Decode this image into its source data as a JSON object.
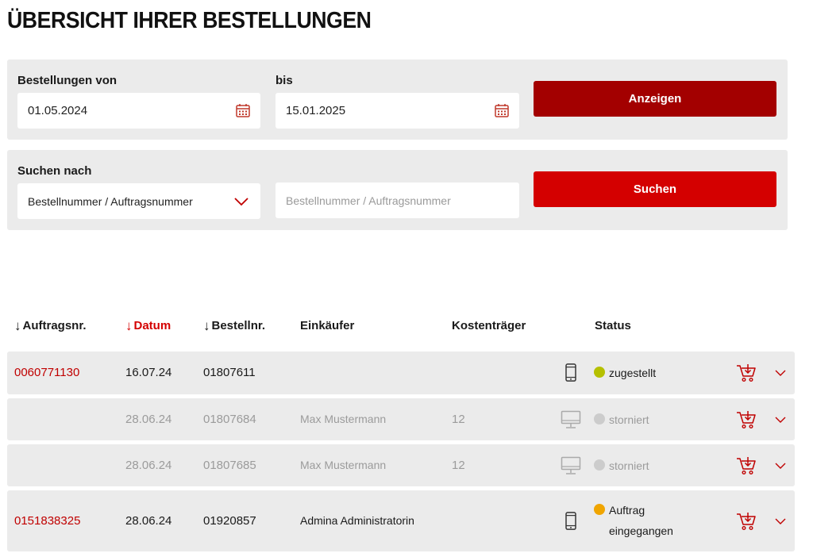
{
  "page": {
    "title": "ÜBERSICHT IHRER BESTELLUNGEN"
  },
  "date_filter": {
    "from_label": "Bestellungen von",
    "from_value": "01.05.2024",
    "to_label": "bis",
    "to_value": "15.01.2025",
    "button_label": "Anzeigen"
  },
  "search": {
    "label": "Suchen nach",
    "select_value": "Bestellnummer / Auftragsnummer",
    "input_placeholder": "Bestellnummer / Auftragsnummer",
    "button_label": "Suchen"
  },
  "table": {
    "headers": {
      "auftragsnr": "Auftragsnr.",
      "datum": "Datum",
      "bestellnr": "Bestellnr.",
      "einkaeufer": "Einkäufer",
      "kostentraeger": "Kostenträger",
      "status": "Status"
    },
    "rows": [
      {
        "auftragsnr": "0060771130",
        "datum": "16.07.24",
        "bestellnr": "01807611",
        "einkaeufer": "",
        "kostentraeger": "",
        "device": "mobile-icon",
        "status_line1": "zugestellt",
        "status_line2": "",
        "status_color": "#b5c000",
        "muted": false
      },
      {
        "auftragsnr": "",
        "datum": "28.06.24",
        "bestellnr": "01807684",
        "einkaeufer": "Max Mustermann",
        "kostentraeger": "12",
        "device": "desktop-icon",
        "status_line1": "storniert",
        "status_line2": "",
        "status_color": "#cccccc",
        "muted": true
      },
      {
        "auftragsnr": "",
        "datum": "28.06.24",
        "bestellnr": "01807685",
        "einkaeufer": "Max Mustermann",
        "kostentraeger": "12",
        "device": "desktop-icon",
        "status_line1": "storniert",
        "status_line2": "",
        "status_color": "#cccccc",
        "muted": true
      },
      {
        "auftragsnr": "0151838325",
        "datum": "28.06.24",
        "bestellnr": "01920857",
        "einkaeufer": "Admina Administratorin",
        "kostentraeger": "",
        "device": "mobile-icon",
        "status_line1": "Auftrag",
        "status_line2": "eingegangen",
        "status_color": "#f0a500",
        "muted": false
      }
    ]
  },
  "colors": {
    "accent_red": "#d40000",
    "dark_red": "#a30000",
    "panel_bg": "#ebebeb"
  }
}
